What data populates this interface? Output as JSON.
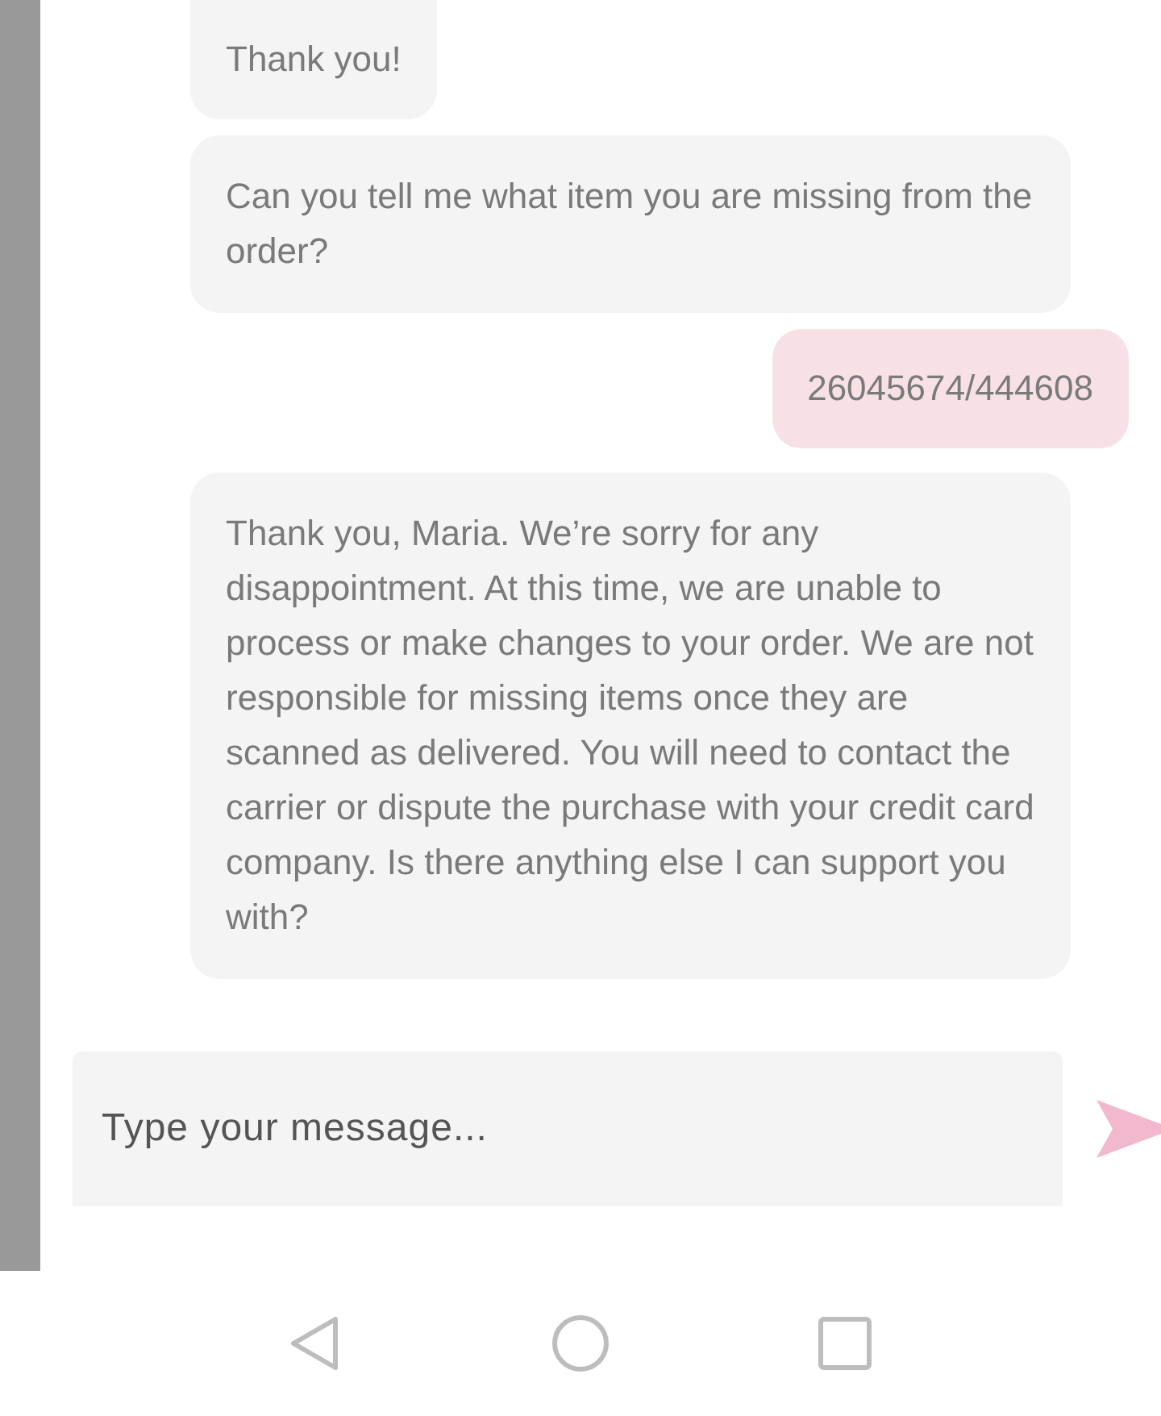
{
  "messages": [
    {
      "kind": "agent",
      "text": "Thank you!"
    },
    {
      "kind": "agent",
      "text": "Can you tell me what item you are missing from the order?"
    },
    {
      "kind": "user",
      "text": "26045674/444608"
    },
    {
      "kind": "agent",
      "text": "Thank you, Maria. We’re sorry for any disappointment. At this time, we are unable to process or make changes to your order. We are not responsible for missing items once they are scanned as delivered. You will need to contact the carrier or dispute the purchase with your credit card company. Is there anything else I can support you with?"
    }
  ],
  "composer": {
    "placeholder": "Type your message..."
  }
}
